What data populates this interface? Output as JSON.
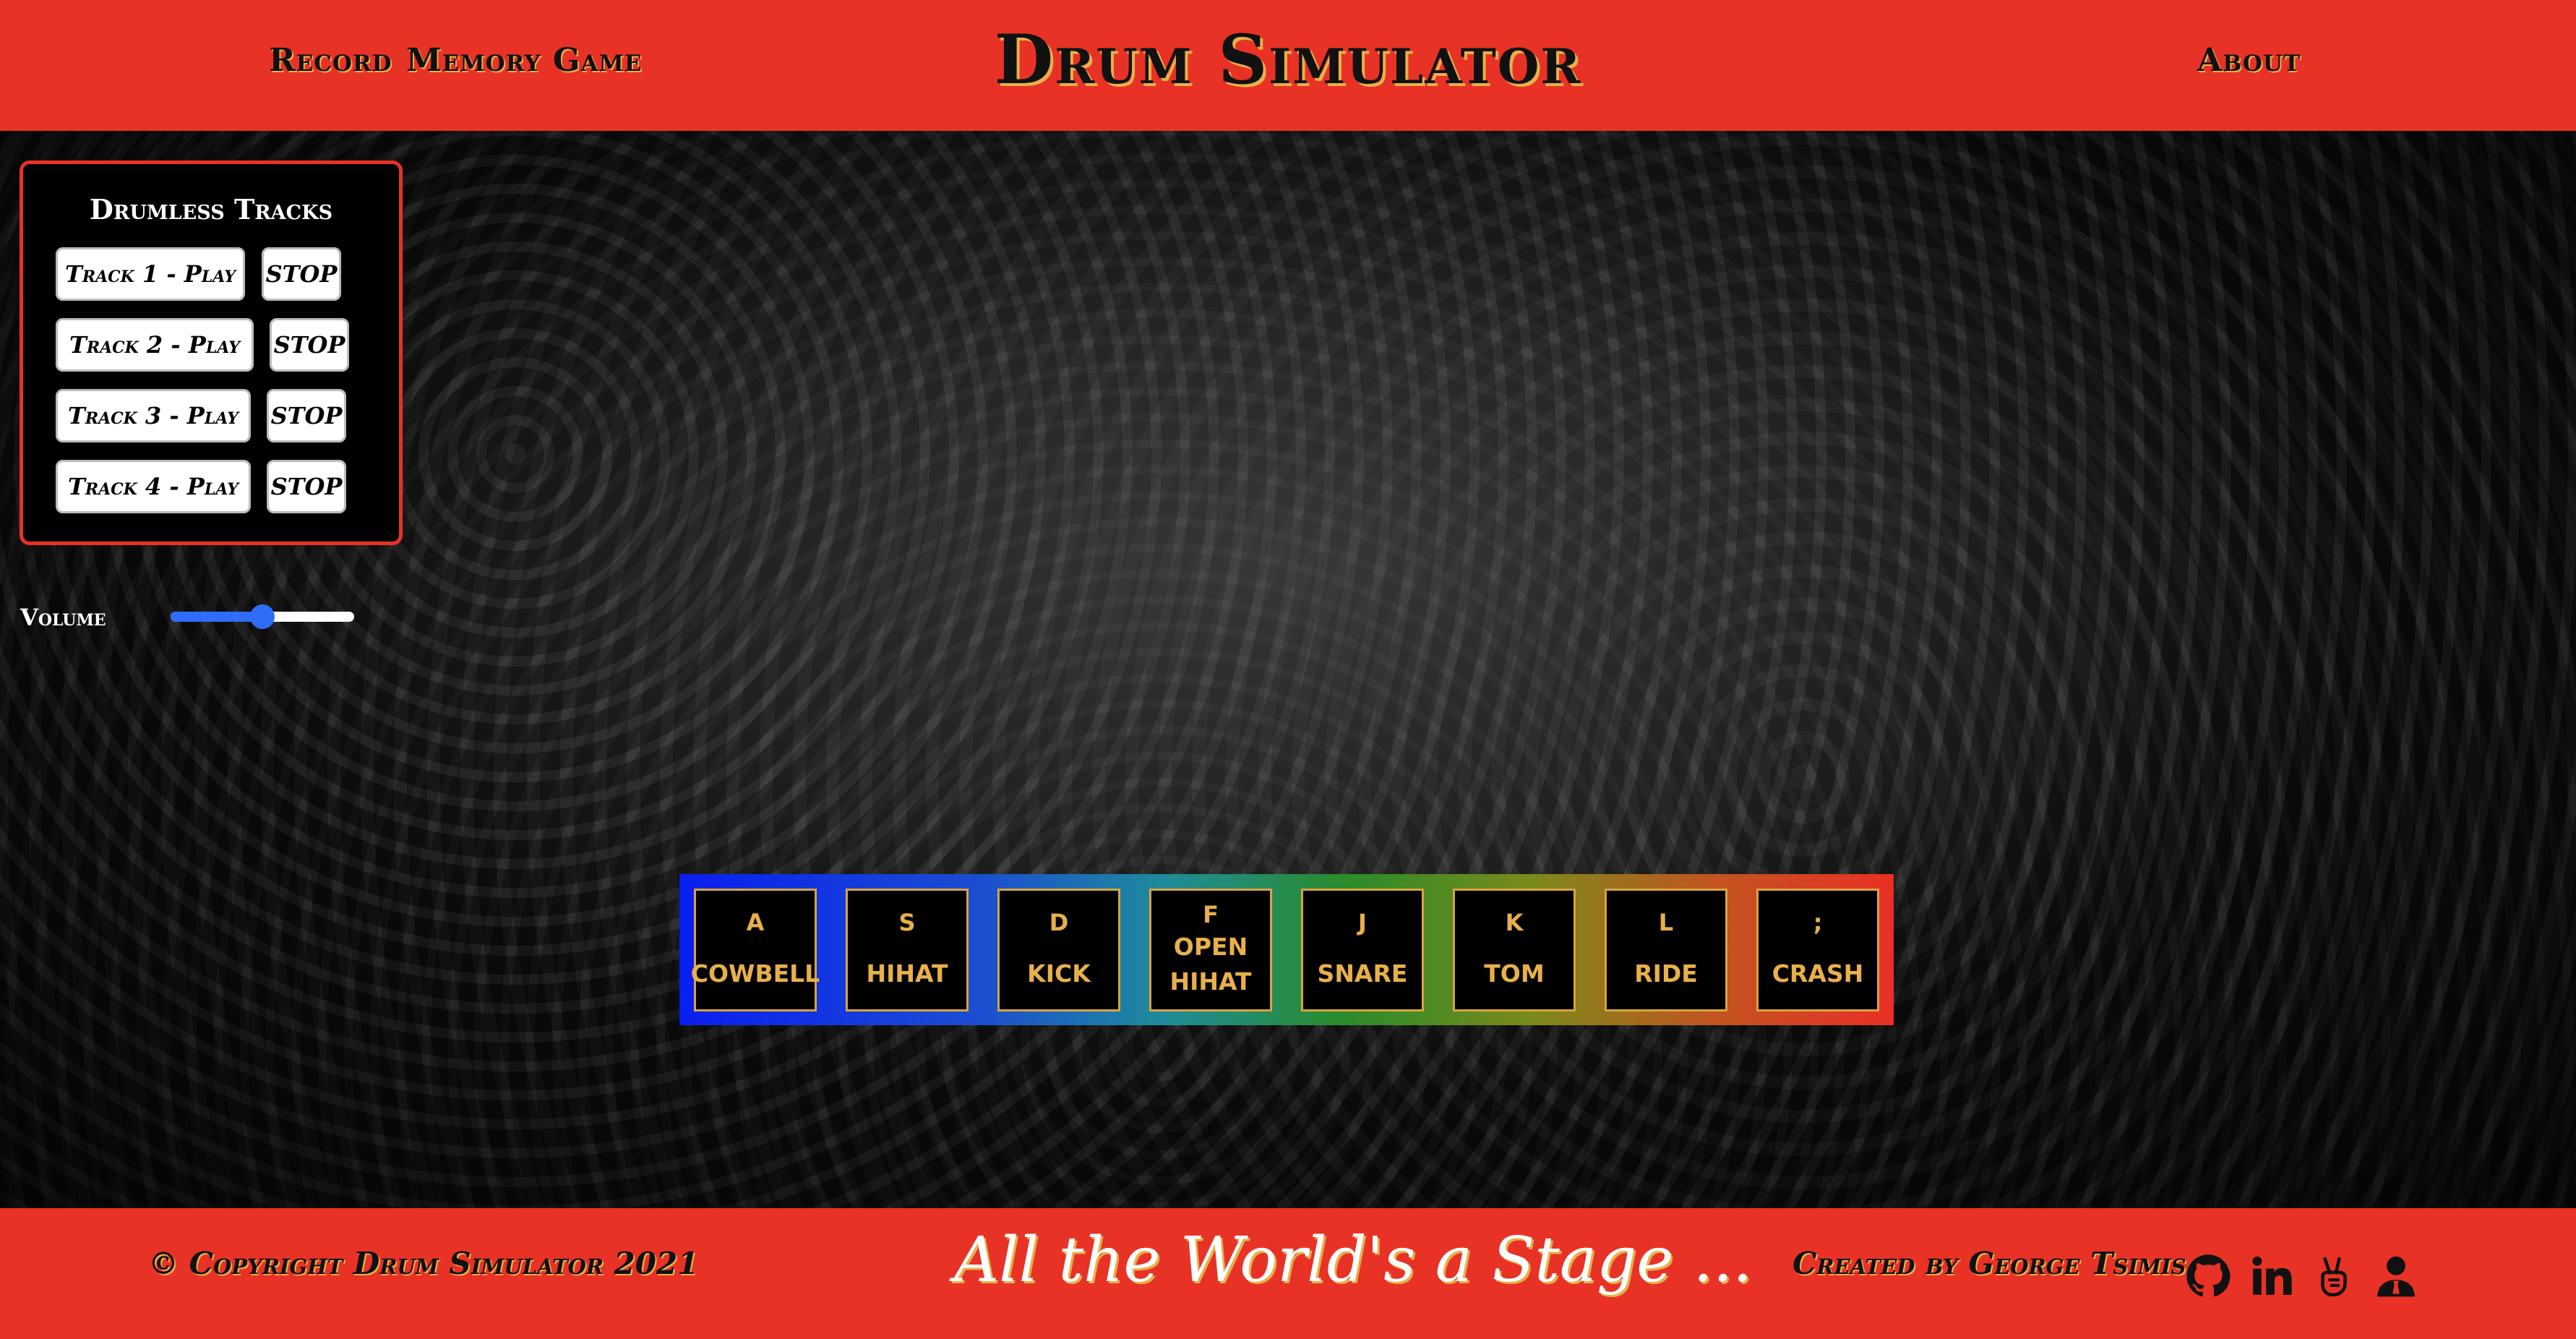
{
  "header": {
    "nav_record": "Record",
    "nav_memory_game": "Memory Game",
    "title": "Drum Simulator",
    "nav_about": "About"
  },
  "tracks_panel": {
    "title": "Drumless Tracks",
    "tracks": [
      {
        "play_label": "Track 1 - Play",
        "stop_label": "STOP"
      },
      {
        "play_label": "Track 2 - Play",
        "stop_label": "STOP"
      },
      {
        "play_label": "Track 3 - Play",
        "stop_label": "STOP"
      },
      {
        "play_label": "Track 4 - Play",
        "stop_label": "STOP"
      }
    ]
  },
  "volume": {
    "label": "Volume",
    "level": 0.5
  },
  "pads": [
    {
      "key": "A",
      "sound": "COWBELL"
    },
    {
      "key": "S",
      "sound": "HIHAT"
    },
    {
      "key": "D",
      "sound": "KICK"
    },
    {
      "key": "F",
      "sound": "OPEN HIHAT"
    },
    {
      "key": "J",
      "sound": "SNARE"
    },
    {
      "key": "K",
      "sound": "TOM"
    },
    {
      "key": "L",
      "sound": "RIDE"
    },
    {
      "key": ";",
      "sound": "CRASH"
    }
  ],
  "footer": {
    "copyright": "© Copyright Drum Simulator 2021",
    "tagline": "All the World's a Stage ...",
    "credit": "Created by George Tsimis",
    "icons": [
      "github-icon",
      "linkedin-icon",
      "peace-hand-icon",
      "user-icon"
    ]
  },
  "colors": {
    "brand_red": "#e83226",
    "pad_gold": "#d9a441",
    "slider_blue": "#2f6df6"
  }
}
